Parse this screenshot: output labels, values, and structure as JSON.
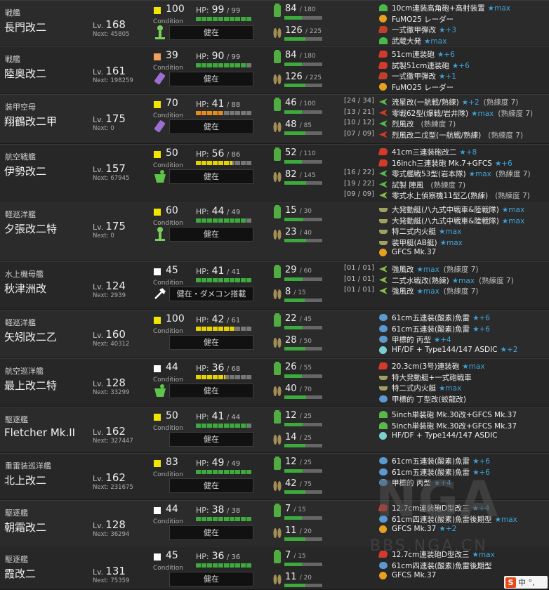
{
  "colors": {
    "green": "#3caa3c",
    "yellow": "#e6d200",
    "orange": "#e68a1e",
    "red": "#d43a2a",
    "cond_yellow": "#f2e600",
    "cond_orange": "#f0a060",
    "cond_white": "#ffffff",
    "star": "#3fa3d8"
  },
  "icon_colors": {
    "gun": "#d43a2a",
    "aa": "#4bb84b",
    "radar": "#e8a020",
    "ap": "#c0402a",
    "plane_fighter": "#5ab84a",
    "plane_bomber": "#d43a2a",
    "plane_torpedo": "#4a9ad6",
    "seaplane": "#8ab84a",
    "torpedo": "#5a9ad0",
    "small": "#5ab84a",
    "sonar": "#7ad0d0",
    "landing": "#a0a060",
    "other": "#a0a0a0"
  },
  "ships": [
    {
      "type": "戦艦",
      "name": "長門改二",
      "lv_label": "Lv.",
      "lv": "168",
      "next": "Next: 45805",
      "cond": "100",
      "cond_color": "cond_yellow",
      "cond_label": "Condition",
      "hp_label": "HP:",
      "hp_cur": "99",
      "hp_max": "/ 99",
      "hp_frac": 1.0,
      "hp_color": "green",
      "status": "健在",
      "status_icon": "green-person-icon",
      "fuel": "84",
      "fuel_max": "/ 180",
      "fuel_frac": 0.47,
      "ammo": "126",
      "ammo_max": "/ 225",
      "ammo_frac": 0.56,
      "equip": [
        {
          "slot": "",
          "icon": "aa",
          "name": "10cm連装高角砲+高射装置",
          "star": "★max",
          "prof": ""
        },
        {
          "slot": "",
          "icon": "radar",
          "name": "FuMO25 レーダー",
          "star": "",
          "prof": ""
        },
        {
          "slot": "",
          "icon": "ap",
          "name": "一式徹甲弾改",
          "star": "★+3",
          "prof": ""
        },
        {
          "slot": "",
          "icon": "aa",
          "name": "武蔵大発",
          "star": "★max",
          "prof": ""
        }
      ]
    },
    {
      "type": "戦艦",
      "name": "陸奥改二",
      "lv_label": "Lv.",
      "lv": "161",
      "next": "Next: 198259",
      "cond": "39",
      "cond_color": "cond_orange",
      "cond_label": "Condition",
      "hp_label": "HP:",
      "hp_cur": "90",
      "hp_max": "/ 99",
      "hp_frac": 0.91,
      "hp_color": "green",
      "status": "健在",
      "status_icon": "purple-bomb-icon",
      "fuel": "84",
      "fuel_max": "/ 180",
      "fuel_frac": 0.47,
      "ammo": "126",
      "ammo_max": "/ 225",
      "ammo_frac": 0.56,
      "equip": [
        {
          "slot": "",
          "icon": "gun",
          "name": "51cm連装砲",
          "star": "★+6",
          "prof": ""
        },
        {
          "slot": "",
          "icon": "gun",
          "name": "試製51cm連装砲",
          "star": "★+6",
          "prof": ""
        },
        {
          "slot": "",
          "icon": "ap",
          "name": "一式徹甲弾改",
          "star": "★+1",
          "prof": ""
        },
        {
          "slot": "",
          "icon": "radar",
          "name": "FuMO25 レーダー",
          "star": "",
          "prof": ""
        }
      ]
    },
    {
      "type": "装甲空母",
      "name": "翔鶴改二甲",
      "lv_label": "Lv.",
      "lv": "175",
      "next": "Next: 0",
      "cond": "70",
      "cond_color": "cond_yellow",
      "cond_label": "Condition",
      "hp_label": "HP:",
      "hp_cur": "41",
      "hp_max": "/ 88",
      "hp_frac": 0.47,
      "hp_color": "orange",
      "status": "健在",
      "status_icon": "purple-bomb-icon",
      "fuel": "46",
      "fuel_max": "/ 100",
      "fuel_frac": 0.46,
      "ammo": "48",
      "ammo_max": "/ 85",
      "ammo_frac": 0.56,
      "equip": [
        {
          "slot": "[24 / 34]",
          "icon": "plane_fighter",
          "name": "流星改(一航戦/熟練)",
          "star": "★+2",
          "prof": "(熟練度 7)"
        },
        {
          "slot": "[13 / 21]",
          "icon": "plane_bomber",
          "name": "零戦62型(爆戦/岩井隊)",
          "star": "★max",
          "prof": "(熟練度 7)"
        },
        {
          "slot": "[10 / 12]",
          "icon": "plane_fighter",
          "name": "烈風改",
          "star": "",
          "prof": "(熟練度 7)"
        },
        {
          "slot": "[07 / 09]",
          "icon": "plane_bomber",
          "name": "烈風改二戊型(一航戦/熟練)",
          "star": "",
          "prof": "(熟練度 7)"
        }
      ]
    },
    {
      "type": "航空戦艦",
      "name": "伊勢改二",
      "lv_label": "Lv.",
      "lv": "157",
      "next": "Next: 67945",
      "cond": "50",
      "cond_color": "cond_yellow",
      "cond_label": "Condition",
      "hp_label": "HP:",
      "hp_cur": "56",
      "hp_max": "/ 86",
      "hp_frac": 0.65,
      "hp_color": "yellow",
      "status": "健在",
      "status_icon": "green-bucket-icon",
      "fuel": "52",
      "fuel_max": "/ 110",
      "fuel_frac": 0.47,
      "ammo": "82",
      "ammo_max": "/ 145",
      "ammo_frac": 0.57,
      "equip": [
        {
          "slot": "",
          "icon": "gun",
          "name": "41cm三連装砲改二",
          "star": "★+8",
          "prof": ""
        },
        {
          "slot": "",
          "icon": "gun",
          "name": "16inch三連装砲 Mk.7+GFCS",
          "star": "★+6",
          "prof": ""
        },
        {
          "slot": "[16 / 22]",
          "icon": "plane_fighter",
          "name": "零式艦戦53型(岩本隊)",
          "star": "★max",
          "prof": "(熟練度 7)"
        },
        {
          "slot": "[19 / 22]",
          "icon": "plane_fighter",
          "name": "試製 陣風",
          "star": "",
          "prof": "(熟練度 7)"
        },
        {
          "slot": "[09 / 09]",
          "icon": "seaplane",
          "name": "零式水上偵察機11型乙(熟練)",
          "star": "",
          "prof": "(熟練度 7)"
        }
      ]
    },
    {
      "type": "軽巡洋艦",
      "name": "夕張改二特",
      "lv_label": "Lv.",
      "lv": "175",
      "next": "Next: 0",
      "cond": "60",
      "cond_color": "cond_yellow",
      "cond_label": "Condition",
      "hp_label": "HP:",
      "hp_cur": "44",
      "hp_max": "/ 49",
      "hp_frac": 0.9,
      "hp_color": "green",
      "status": "健在",
      "status_icon": "green-person-icon",
      "fuel": "15",
      "fuel_max": "/ 30",
      "fuel_frac": 0.5,
      "ammo": "23",
      "ammo_max": "/ 40",
      "ammo_frac": 0.57,
      "equip": [
        {
          "slot": "",
          "icon": "landing",
          "name": "大発動艇(八九式中戦車&陸戦隊)",
          "star": "★max",
          "prof": ""
        },
        {
          "slot": "",
          "icon": "landing",
          "name": "大発動艇(八九式中戦車&陸戦隊)",
          "star": "★max",
          "prof": ""
        },
        {
          "slot": "",
          "icon": "landing",
          "name": "特二式内火艇",
          "star": "★max",
          "prof": ""
        },
        {
          "slot": "",
          "icon": "landing",
          "name": "装甲艇(AB艇)",
          "star": "★max",
          "prof": ""
        },
        {
          "slot": "",
          "icon": "radar",
          "name": "GFCS Mk.37",
          "star": "",
          "prof": ""
        }
      ]
    },
    {
      "type": "水上機母艦",
      "name": "秋津洲改",
      "lv_label": "Lv.",
      "lv": "124",
      "next": "Next: 2939",
      "cond": "45",
      "cond_color": "cond_white",
      "cond_label": "Condition",
      "hp_label": "HP:",
      "hp_cur": "41",
      "hp_max": "/ 41",
      "hp_frac": 1.0,
      "hp_color": "green",
      "status": "健在・ダメコン搭載",
      "status_icon": "white-tool-icon",
      "fuel": "29",
      "fuel_max": "/ 60",
      "fuel_frac": 0.48,
      "ammo": "8",
      "ammo_max": "/ 15",
      "ammo_frac": 0.53,
      "equip": [
        {
          "slot": "[01 / 01]",
          "icon": "seaplane",
          "name": "強風改",
          "star": "★max",
          "prof": "(熟練度 7)"
        },
        {
          "slot": "[01 / 01]",
          "icon": "seaplane",
          "name": "二式水戦改(熟練)",
          "star": "★max",
          "prof": "(熟練度 7)"
        },
        {
          "slot": "[01 / 01]",
          "icon": "seaplane",
          "name": "強風改",
          "star": "★max",
          "prof": "(熟練度 7)"
        }
      ]
    },
    {
      "type": "軽巡洋艦",
      "name": "矢矧改二乙",
      "lv_label": "Lv.",
      "lv": "160",
      "next": "Next: 40312",
      "cond": "100",
      "cond_color": "cond_yellow",
      "cond_label": "Condition",
      "hp_label": "HP:",
      "hp_cur": "42",
      "hp_max": "/ 61",
      "hp_frac": 0.69,
      "hp_color": "yellow",
      "status": "健在",
      "status_icon": "",
      "fuel": "22",
      "fuel_max": "/ 45",
      "fuel_frac": 0.49,
      "ammo": "28",
      "ammo_max": "/ 50",
      "ammo_frac": 0.56,
      "equip": [
        {
          "slot": "",
          "icon": "torpedo",
          "name": "61cm五連装(酸素)魚雷",
          "star": "★+6",
          "prof": ""
        },
        {
          "slot": "",
          "icon": "torpedo",
          "name": "61cm五連装(酸素)魚雷",
          "star": "★+6",
          "prof": ""
        },
        {
          "slot": "",
          "icon": "torpedo",
          "name": "甲標的 丙型",
          "star": "★+4",
          "prof": ""
        },
        {
          "slot": "",
          "icon": "sonar",
          "name": "HF/DF + Type144/147 ASDIC",
          "star": "★+2",
          "prof": ""
        }
      ]
    },
    {
      "type": "航空巡洋艦",
      "name": "最上改二特",
      "lv_label": "Lv.",
      "lv": "128",
      "next": "Next: 33299",
      "cond": "44",
      "cond_color": "cond_white",
      "cond_label": "Condition",
      "hp_label": "HP:",
      "hp_cur": "36",
      "hp_max": "/ 68",
      "hp_frac": 0.53,
      "hp_color": "yellow",
      "status": "健在",
      "status_icon": "green-bucket-icon",
      "fuel": "26",
      "fuel_max": "/ 55",
      "fuel_frac": 0.47,
      "ammo": "40",
      "ammo_max": "/ 70",
      "ammo_frac": 0.57,
      "equip": [
        {
          "slot": "",
          "icon": "gun",
          "name": "20.3cm(3号)連装砲",
          "star": "★max",
          "prof": ""
        },
        {
          "slot": "",
          "icon": "landing",
          "name": "特大発動艇+一式砲戦車",
          "star": "",
          "prof": ""
        },
        {
          "slot": "",
          "icon": "landing",
          "name": "特二式内火艇",
          "star": "★max",
          "prof": ""
        },
        {
          "slot": "",
          "icon": "torpedo",
          "name": "甲標的 丁型改(蛟龍改)",
          "star": "",
          "prof": ""
        }
      ]
    },
    {
      "type": "駆逐艦",
      "name": "Fletcher Mk.II",
      "lv_label": "Lv.",
      "lv": "162",
      "next": "Next: 327447",
      "cond": "50",
      "cond_color": "cond_yellow",
      "cond_label": "Condition",
      "hp_label": "HP:",
      "hp_cur": "41",
      "hp_max": "/ 44",
      "hp_frac": 0.93,
      "hp_color": "green",
      "status": "健在",
      "status_icon": "",
      "fuel": "12",
      "fuel_max": "/ 25",
      "fuel_frac": 0.48,
      "ammo": "14",
      "ammo_max": "/ 25",
      "ammo_frac": 0.56,
      "equip": [
        {
          "slot": "",
          "icon": "small",
          "name": "5inch単装砲 Mk.30改+GFCS Mk.37",
          "star": "",
          "prof": ""
        },
        {
          "slot": "",
          "icon": "small",
          "name": "5inch単装砲 Mk.30改+GFCS Mk.37",
          "star": "",
          "prof": ""
        },
        {
          "slot": "",
          "icon": "sonar",
          "name": "HF/DF + Type144/147 ASDIC",
          "star": "",
          "prof": ""
        }
      ]
    },
    {
      "type": "重雷装巡洋艦",
      "name": "北上改二",
      "lv_label": "Lv.",
      "lv": "162",
      "next": "Next: 231675",
      "cond": "83",
      "cond_color": "cond_yellow",
      "cond_label": "Condition",
      "hp_label": "HP:",
      "hp_cur": "49",
      "hp_max": "/ 49",
      "hp_frac": 1.0,
      "hp_color": "green",
      "status": "健在",
      "status_icon": "",
      "fuel": "12",
      "fuel_max": "/ 25",
      "fuel_frac": 0.48,
      "ammo": "42",
      "ammo_max": "/ 75",
      "ammo_frac": 0.56,
      "equip": [
        {
          "slot": "",
          "icon": "torpedo",
          "name": "61cm五連装(酸素)魚雷",
          "star": "★+6",
          "prof": ""
        },
        {
          "slot": "",
          "icon": "torpedo",
          "name": "61cm五連装(酸素)魚雷",
          "star": "★+6",
          "prof": ""
        },
        {
          "slot": "",
          "icon": "torpedo",
          "name": "甲標的 丙型",
          "star": "★+4",
          "prof": ""
        }
      ]
    },
    {
      "type": "駆逐艦",
      "name": "朝霜改二",
      "lv_label": "Lv.",
      "lv": "128",
      "next": "Next: 36294",
      "cond": "44",
      "cond_color": "cond_white",
      "cond_label": "Condition",
      "hp_label": "HP:",
      "hp_cur": "38",
      "hp_max": "/ 38",
      "hp_frac": 1.0,
      "hp_color": "green",
      "status": "健在",
      "status_icon": "",
      "fuel": "7",
      "fuel_max": "/ 15",
      "fuel_frac": 0.47,
      "ammo": "11",
      "ammo_max": "/ 20",
      "ammo_frac": 0.55,
      "equip": [
        {
          "slot": "",
          "icon": "gun",
          "name": "12.7cm連装砲D型改三",
          "star": "★+4",
          "prof": ""
        },
        {
          "slot": "",
          "icon": "torpedo",
          "name": "61cm四連装(酸素)魚雷後期型",
          "star": "★max",
          "prof": ""
        },
        {
          "slot": "",
          "icon": "radar",
          "name": "GFCS Mk.37",
          "star": "★+2",
          "prof": ""
        }
      ]
    },
    {
      "type": "駆逐艦",
      "name": "霞改二",
      "lv_label": "Lv.",
      "lv": "131",
      "next": "Next: 75359",
      "cond": "45",
      "cond_color": "cond_white",
      "cond_label": "Condition",
      "hp_label": "HP:",
      "hp_cur": "36",
      "hp_max": "/ 36",
      "hp_frac": 1.0,
      "hp_color": "green",
      "status": "健在",
      "status_icon": "",
      "fuel": "7",
      "fuel_max": "/ 15",
      "fuel_frac": 0.47,
      "ammo": "11",
      "ammo_max": "/ 20",
      "ammo_frac": 0.55,
      "equip": [
        {
          "slot": "",
          "icon": "gun",
          "name": "12.7cm連装砲D型改三",
          "star": "★max",
          "prof": ""
        },
        {
          "slot": "",
          "icon": "torpedo",
          "name": "61cm四連装(酸素)魚雷後期型",
          "star": "",
          "prof": ""
        },
        {
          "slot": "",
          "icon": "radar",
          "name": "GFCS Mk.37",
          "star": "",
          "prof": ""
        }
      ]
    }
  ],
  "watermark": {
    "logo": "NGA",
    "url": "BBS.NGA.CN"
  },
  "ime": {
    "mark": "S",
    "label": "中 °,"
  }
}
